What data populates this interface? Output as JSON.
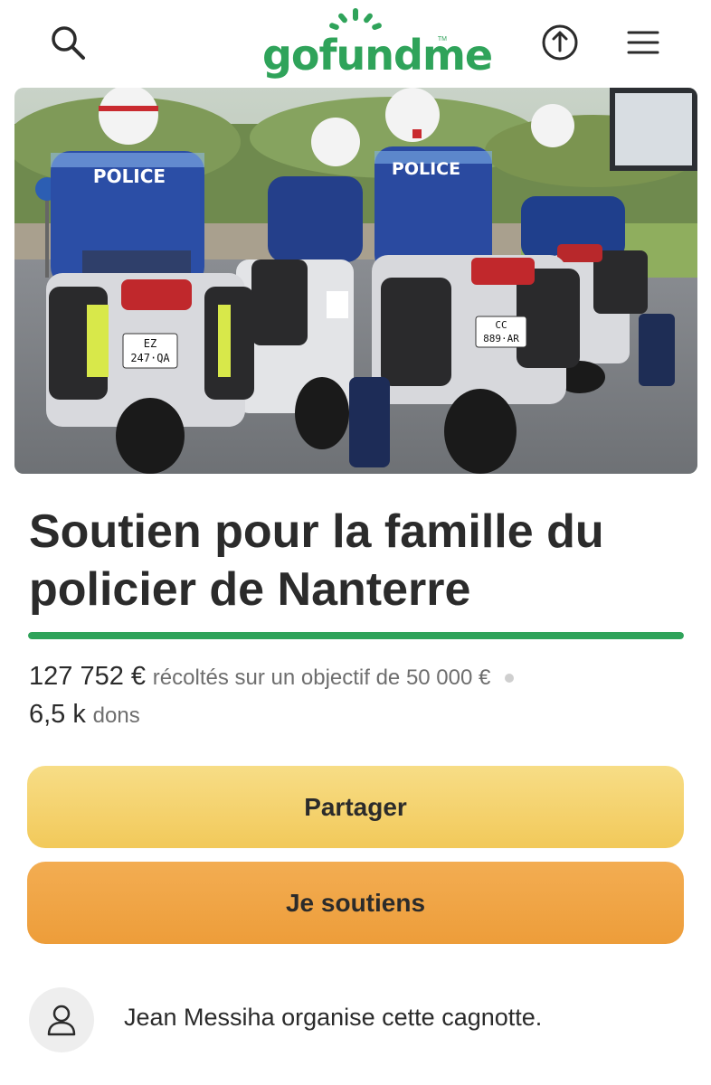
{
  "header": {
    "logo_text": "gofundme",
    "logo_tm": "TM",
    "icons": {
      "search": "search-icon",
      "share": "upload-share-icon",
      "menu": "hamburger-menu-icon"
    }
  },
  "hero": {
    "police_label": "POLICE",
    "plate_1a": "EZ",
    "plate_1b": "247·QA",
    "plate_2a": "CC",
    "plate_2b": "889·AR"
  },
  "campaign": {
    "title": "Soutien pour la famille du policier de Nanterre",
    "progress_fraction": 1.0,
    "raised_amount": "127 752 €",
    "raised_text": "récoltés sur un objectif de 50 000 €",
    "donations_count": "6,5 k",
    "donations_label": "dons"
  },
  "buttons": {
    "share_label": "Partager",
    "donate_label": "Je soutiens"
  },
  "organizer": {
    "text": "Jean Messiha organise cette cagnotte."
  },
  "colors": {
    "brand_green": "#2fa35a",
    "share_button": "#f2c95a",
    "donate_button": "#ed9d3a"
  }
}
